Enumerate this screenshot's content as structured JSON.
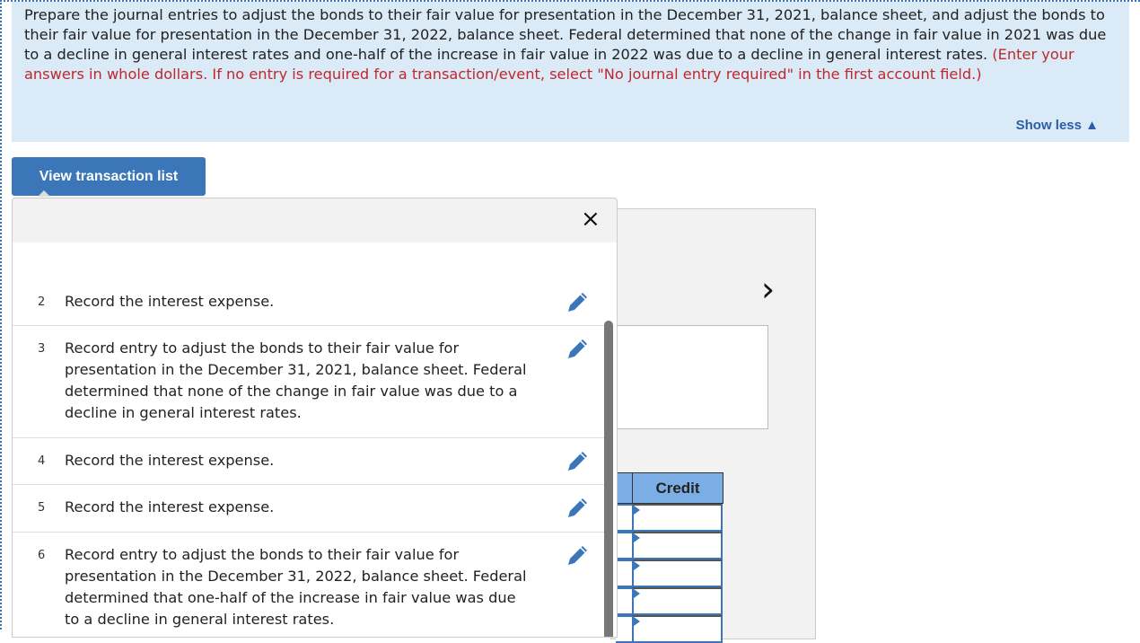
{
  "instructions": {
    "text": "Prepare the journal entries to adjust the bonds to their fair value for presentation in the December 31, 2021, balance sheet, and adjust the bonds to their fair value for presentation in the December 31, 2022, balance sheet. Federal determined that none of the change in fair value in 2021 was due to a decline in general interest rates and one-half of the increase in fair value in 2022 was due to a decline in general interest rates.",
    "note": "(Enter your answers in whole dollars. If no entry is required for a transaction/event, select \"No journal entry required\" in the first account field.)",
    "show_less": "Show less ▲"
  },
  "view_transaction_list": "View transaction list",
  "popup": {
    "close": "×",
    "items": [
      {
        "num": "2",
        "text": "Record the interest expense."
      },
      {
        "num": "3",
        "text": "Record entry to adjust the bonds to their fair value for presentation in the December 31, 2021, balance sheet. Federal determined that none of the change in fair value was due to a decline in general interest rates."
      },
      {
        "num": "4",
        "text": "Record the interest expense."
      },
      {
        "num": "5",
        "text": "Record the interest expense."
      },
      {
        "num": "6",
        "text": "Record entry to adjust the bonds to their fair value for presentation in the December 31, 2022, balance sheet. Federal determined that one-half of the increase in fair value was due to a decline in general interest rates."
      }
    ]
  },
  "journal": {
    "credit_header": "Credit",
    "next": "›"
  },
  "colors": {
    "accent": "#3a76b8",
    "info_bg": "#daeaf7",
    "note_red": "#c0282c",
    "header_blue": "#7aaee4"
  }
}
